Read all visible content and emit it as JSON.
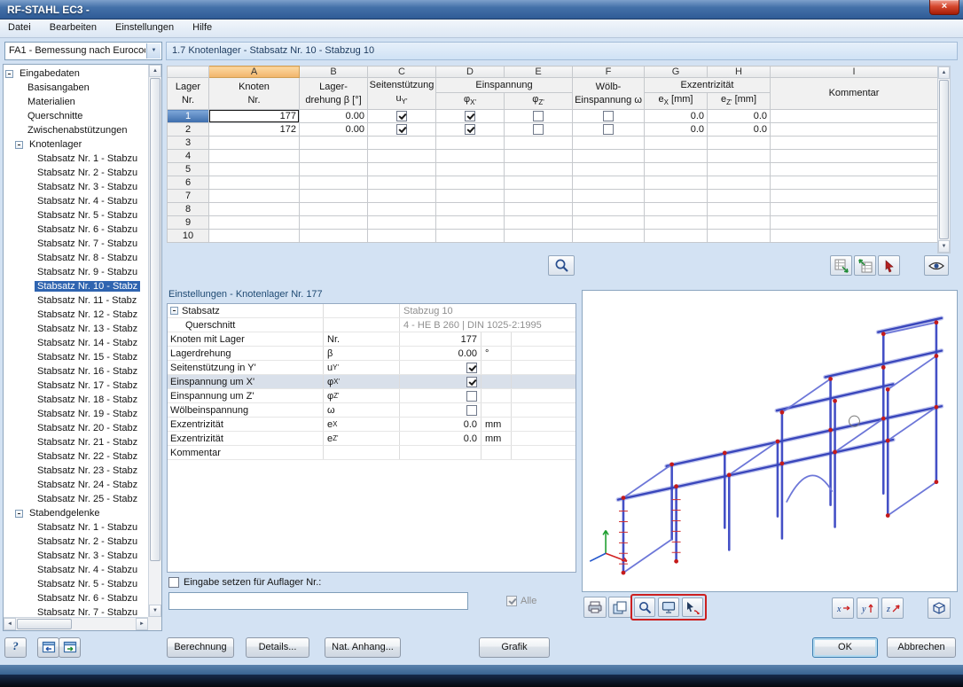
{
  "window": {
    "title": "RF-STAHL EC3 -",
    "close_glyph": "×"
  },
  "menu": {
    "items": [
      "Datei",
      "Bearbeiten",
      "Einstellungen",
      "Hilfe"
    ]
  },
  "toolbar": {
    "case_selector": "FA1 - Bemessung nach Eurocod",
    "section_title": "1.7 Knotenlager - Stabsatz Nr. 10 - Stabzug 10"
  },
  "icons": {
    "combo_arrow": "▼",
    "up": "▲",
    "down": "▼",
    "left": "◄",
    "right": "►"
  },
  "sidebar": {
    "items": [
      {
        "label": "Eingabedaten",
        "level": 0,
        "expander": true
      },
      {
        "label": "Basisangaben",
        "level": 1
      },
      {
        "label": "Materialien",
        "level": 1
      },
      {
        "label": "Querschnitte",
        "level": 1
      },
      {
        "label": "Zwischenabstützungen",
        "level": 1
      },
      {
        "label": "Knotenlager",
        "level": 1,
        "expander": true
      },
      {
        "label": "Stabsatz Nr. 1 - Stabzu",
        "level": 2
      },
      {
        "label": "Stabsatz Nr. 2 - Stabzu",
        "level": 2
      },
      {
        "label": "Stabsatz Nr. 3 - Stabzu",
        "level": 2
      },
      {
        "label": "Stabsatz Nr. 4 - Stabzu",
        "level": 2
      },
      {
        "label": "Stabsatz Nr. 5 - Stabzu",
        "level": 2
      },
      {
        "label": "Stabsatz Nr. 6 - Stabzu",
        "level": 2
      },
      {
        "label": "Stabsatz Nr. 7 - Stabzu",
        "level": 2
      },
      {
        "label": "Stabsatz Nr. 8 - Stabzu",
        "level": 2
      },
      {
        "label": "Stabsatz Nr. 9 - Stabzu",
        "level": 2
      },
      {
        "label": "Stabsatz Nr. 10 - Stabz",
        "level": 2,
        "selected": true
      },
      {
        "label": "Stabsatz Nr. 11 - Stabz",
        "level": 2
      },
      {
        "label": "Stabsatz Nr. 12 - Stabz",
        "level": 2
      },
      {
        "label": "Stabsatz Nr. 13 - Stabz",
        "level": 2
      },
      {
        "label": "Stabsatz Nr. 14 - Stabz",
        "level": 2
      },
      {
        "label": "Stabsatz Nr. 15 - Stabz",
        "level": 2
      },
      {
        "label": "Stabsatz Nr. 16 - Stabz",
        "level": 2
      },
      {
        "label": "Stabsatz Nr. 17 - Stabz",
        "level": 2
      },
      {
        "label": "Stabsatz Nr. 18 - Stabz",
        "level": 2
      },
      {
        "label": "Stabsatz Nr. 19 - Stabz",
        "level": 2
      },
      {
        "label": "Stabsatz Nr. 20 - Stabz",
        "level": 2
      },
      {
        "label": "Stabsatz Nr. 21 - Stabz",
        "level": 2
      },
      {
        "label": "Stabsatz Nr. 22 - Stabz",
        "level": 2
      },
      {
        "label": "Stabsatz Nr. 23 - Stabz",
        "level": 2
      },
      {
        "label": "Stabsatz Nr. 24 - Stabz",
        "level": 2
      },
      {
        "label": "Stabsatz Nr. 25 - Stabz",
        "level": 2
      },
      {
        "label": "Stabendgelenke",
        "level": 1,
        "expander": true
      },
      {
        "label": "Stabsatz Nr. 1 - Stabzu",
        "level": 2
      },
      {
        "label": "Stabsatz Nr. 2 - Stabzu",
        "level": 2
      },
      {
        "label": "Stabsatz Nr. 3 - Stabzu",
        "level": 2
      },
      {
        "label": "Stabsatz Nr. 4 - Stabzu",
        "level": 2
      },
      {
        "label": "Stabsatz Nr. 5 - Stabzu",
        "level": 2
      },
      {
        "label": "Stabsatz Nr. 6 - Stabzu",
        "level": 2
      },
      {
        "label": "Stabsatz Nr. 7 - Stabzu",
        "level": 2
      }
    ]
  },
  "table": {
    "letters": [
      "A",
      "B",
      "C",
      "D",
      "E",
      "F",
      "G",
      "H",
      "I"
    ],
    "header": {
      "lager_l1": "Lager",
      "lager_l2": "Nr.",
      "a_l1": "Knoten",
      "a_l2": "Nr.",
      "b_l1": "Lager-",
      "b_l2": "drehung β [°]",
      "c_l1": "Seitenstützung",
      "c_l2": "u_{Y'}",
      "de": "Einspannung",
      "d": "φ_{X'}",
      "e": "φ_{Z'}",
      "f_l1": "Wölb-",
      "f_l2": "Einspannung ω",
      "gh": "Exzentrizität",
      "g": "e_{X} [mm]",
      "h": "e_{Z'} [mm]",
      "i": "Kommentar"
    },
    "rows": [
      {
        "nr": "1",
        "knoten": "177",
        "beta": "0.00",
        "uy": true,
        "phix": true,
        "phiz": false,
        "omega": false,
        "ex": "0.0",
        "ez": "0.0",
        "komm": "",
        "selected": true,
        "focus": true
      },
      {
        "nr": "2",
        "knoten": "172",
        "beta": "0.00",
        "uy": true,
        "phix": true,
        "phiz": false,
        "omega": false,
        "ex": "0.0",
        "ez": "0.0",
        "komm": ""
      },
      {
        "nr": "3"
      },
      {
        "nr": "4"
      },
      {
        "nr": "5"
      },
      {
        "nr": "6"
      },
      {
        "nr": "7"
      },
      {
        "nr": "8"
      },
      {
        "nr": "9"
      },
      {
        "nr": "10"
      }
    ]
  },
  "settings": {
    "title": "Einstellungen - Knotenlager Nr. 177",
    "rows": [
      {
        "label": "Stabsatz",
        "expander": true,
        "value": "Stabzug 10",
        "gray": true,
        "span": true
      },
      {
        "label": "Querschnitt",
        "indent": true,
        "value": "4 - HE B 260 | DIN 1025-2:1995",
        "gray": true,
        "span": true
      },
      {
        "label": "Knoten mit Lager",
        "sym": "Nr.",
        "value": "177"
      },
      {
        "label": "Lagerdrehung",
        "sym": "β",
        "value": "0.00",
        "unit": "°"
      },
      {
        "label": "Seitenstützung in Y'",
        "sym": "u_{Y'}",
        "check": true
      },
      {
        "label": "Einspannung um X'",
        "sym": "φ_{X'}",
        "check": true,
        "highlight": true
      },
      {
        "label": "Einspannung um Z'",
        "sym": "φ_{Z'}",
        "check": false
      },
      {
        "label": "Wölbeinspannung",
        "sym": "ω",
        "check": false
      },
      {
        "label": "Exzentrizität",
        "sym": "e_{X}",
        "value": "0.0",
        "unit": "mm"
      },
      {
        "label": "Exzentrizität",
        "sym": "e_{Z'}",
        "value": "0.0",
        "unit": "mm"
      },
      {
        "label": "Kommentar"
      }
    ],
    "footer": {
      "set_label": "Eingabe setzen für Auflager Nr.:",
      "input_value": "",
      "alle_label": "Alle"
    }
  },
  "graphic": {
    "axis_labels": [
      "x",
      "y",
      "z"
    ],
    "structure_color": "#3c49c0",
    "marker_color": "#c41a1a",
    "toolbar_icons": [
      "print-graphic",
      "copy-graphic",
      "zoom",
      "full-screen",
      "probe"
    ],
    "view_icons": [
      "view-x",
      "view-y",
      "view-z",
      "isometric-view"
    ]
  },
  "footer": {
    "help_glyph": "?",
    "buttons": {
      "berechnung": "Berechnung",
      "details": "Details...",
      "nat_anhang": "Nat. Anhang...",
      "grafik": "Grafik",
      "ok": "OK",
      "abbrechen": "Abbrechen"
    }
  },
  "colors": {
    "selection_blue": "#3c6cab",
    "column_highlight_orange": "#f1b469",
    "red_marker": "#cc2020"
  }
}
